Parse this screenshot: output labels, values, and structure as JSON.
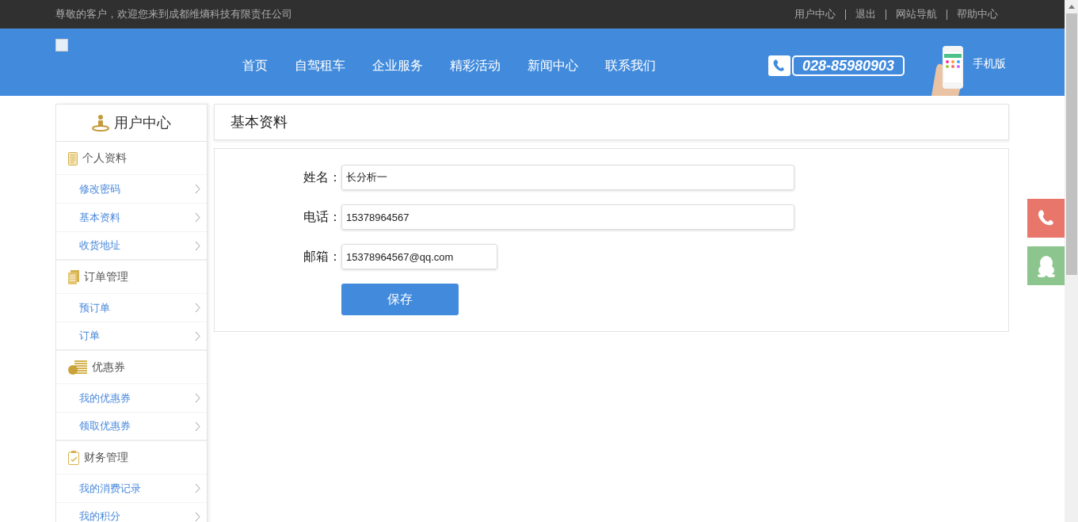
{
  "top_bar": {
    "welcome": "尊敬的客户，欢迎您来到成都维熵科技有限责任公司",
    "links": [
      "用户中心",
      "退出",
      "网站导航",
      "帮助中心"
    ]
  },
  "header": {
    "nav": [
      "首页",
      "自驾租车",
      "企业服务",
      "精彩活动",
      "新闻中心",
      "联系我们"
    ],
    "phone": "028-85980903",
    "mobile_label": "手机版"
  },
  "sidebar": {
    "title": "用户中心",
    "groups": [
      {
        "kind": "profile",
        "label": "个人资料",
        "items": [
          {
            "label": "修改密码"
          },
          {
            "label": "基本资料"
          },
          {
            "label": "收货地址"
          }
        ]
      },
      {
        "kind": "orders",
        "label": "订单管理",
        "items": [
          {
            "label": "预订单"
          },
          {
            "label": "订单"
          }
        ]
      },
      {
        "kind": "coupons",
        "label": "优惠券",
        "items": [
          {
            "label": "我的优惠券"
          },
          {
            "label": "领取优惠券"
          }
        ]
      },
      {
        "kind": "finance",
        "label": "财务管理",
        "items": [
          {
            "label": "我的消费记录"
          },
          {
            "label": "我的积分"
          }
        ]
      }
    ]
  },
  "main": {
    "title": "基本资料",
    "fields": [
      {
        "kind": "long",
        "label": "姓名：",
        "value": "长分析一"
      },
      {
        "kind": "long",
        "label": "电话：",
        "value": "15378964567"
      },
      {
        "kind": "short",
        "label": "邮箱：",
        "value": "15378964567@qq.com"
      }
    ],
    "save_button": "保存"
  },
  "float_buttons": [
    {
      "kind": "phone",
      "color": "#e8766a"
    },
    {
      "kind": "chat",
      "color": "#8cc68e"
    }
  ]
}
